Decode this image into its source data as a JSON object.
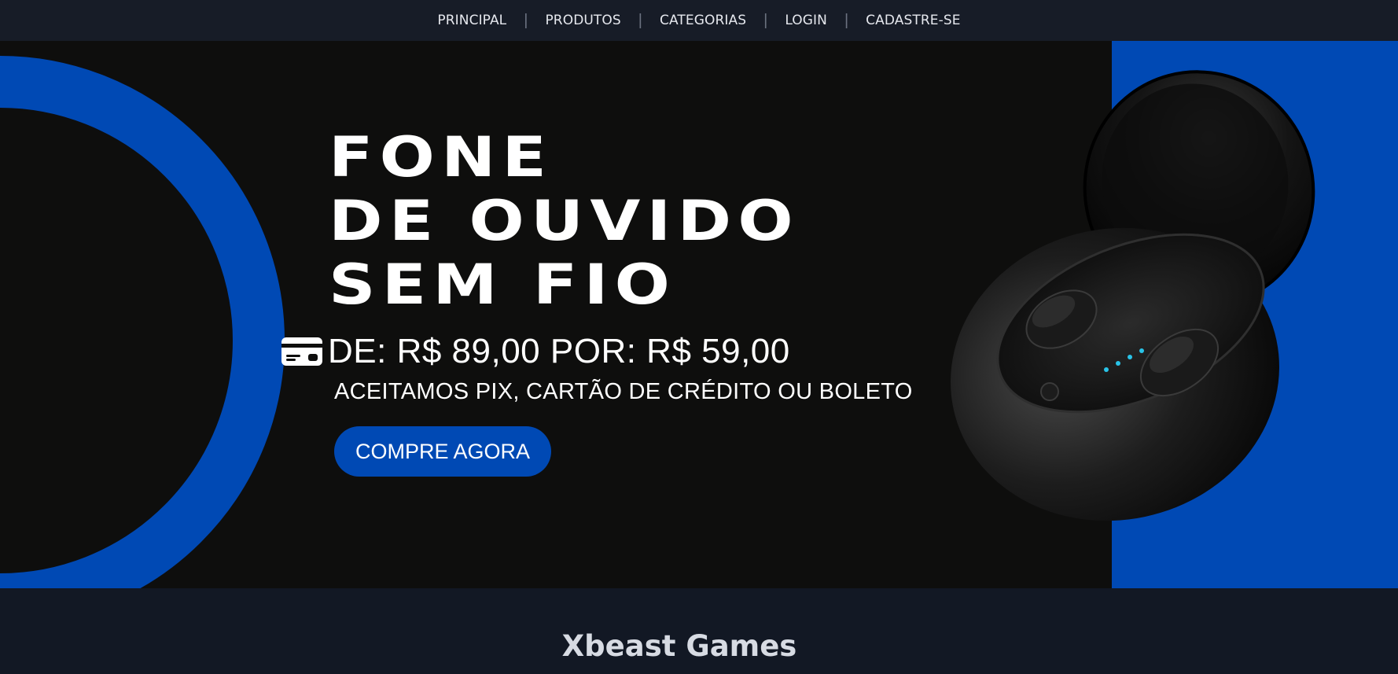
{
  "nav": {
    "items": [
      {
        "label": "PRINCIPAL"
      },
      {
        "label": "PRODUTOS"
      },
      {
        "label": "CATEGORIAS"
      },
      {
        "label": "LOGIN"
      },
      {
        "label": "CADASTRE-SE"
      }
    ],
    "separator": "|"
  },
  "hero": {
    "title_lines": [
      "FONE",
      "DE OUVIDO",
      "SEM FIO"
    ],
    "price": "DE: R$ 89,00 POR: R$ 59,00",
    "payment": "ACEITAMOS PIX, CARTÃO DE CRÉDITO OU BOLETO",
    "cta_label": "COMPRE AGORA",
    "price_icon": "credit-card-icon",
    "accent_color": "#0049b4",
    "background_color": "#0e0e0d"
  },
  "section": {
    "title": "Xbeast Games"
  }
}
